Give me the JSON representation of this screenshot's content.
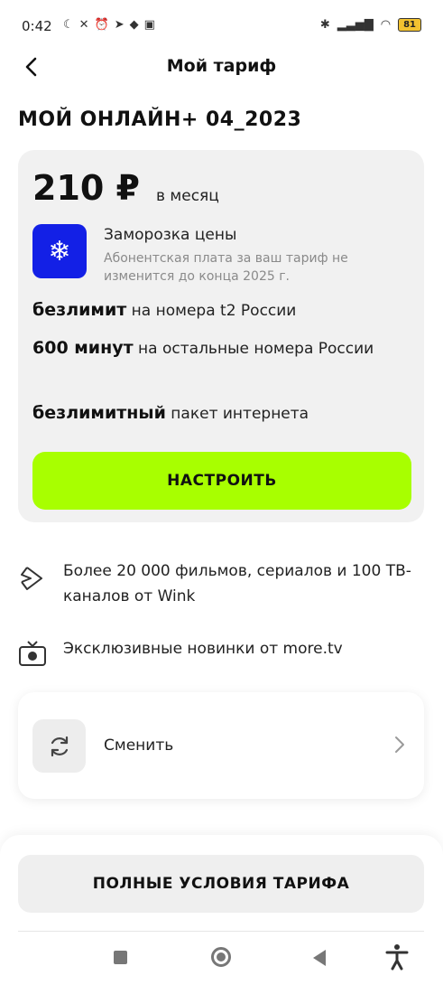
{
  "status_bar": {
    "time": "0:42",
    "battery": "81",
    "left_icons": [
      "moon-icon",
      "mute-icon",
      "alarm-icon",
      "telegram-icon",
      "layers-icon",
      "app-icon"
    ],
    "right_icons": [
      "bluetooth-icon",
      "signal-icon",
      "wifi-icon",
      "battery-icon"
    ]
  },
  "header": {
    "title": "Мой тариф"
  },
  "tariff": {
    "name": "МОЙ ОНЛАЙН+ 04_2023",
    "price": "210 ₽",
    "price_unit": "в месяц",
    "freeze_title": "Заморозка цены",
    "freeze_desc": "Абонентская плата за ваш тариф не изменится до конца 2025 г.",
    "features": [
      {
        "bold": "безлимит",
        "text": " на номера t2 России"
      },
      {
        "bold": "600 минут",
        "text": " на остальные номера России"
      },
      {
        "bold": "безлимитный",
        "text": " пакет интернета"
      }
    ],
    "configure_label": "НАСТРОИТЬ"
  },
  "extras": [
    {
      "icon": "wink-icon",
      "text": "Более 20 000 фильмов, сериалов и 100 ТВ-каналов от Wink"
    },
    {
      "icon": "tv-icon",
      "text": "Эксклюзивные новинки от more.tv"
    }
  ],
  "change": {
    "label": "Сменить"
  },
  "bottom": {
    "terms_label": "ПОЛНЫЕ УСЛОВИЯ ТАРИФА"
  },
  "colors": {
    "accent_green": "#a8ff00",
    "freeze_blue": "#1320e6",
    "card_bg": "#f1f1f1"
  }
}
